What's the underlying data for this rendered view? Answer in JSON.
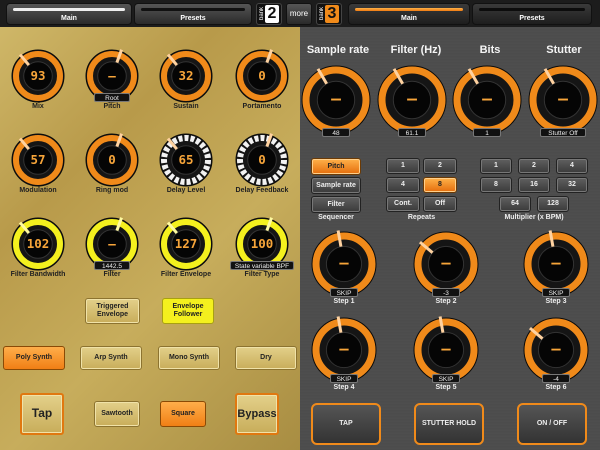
{
  "left_tabs": {
    "main": "Main",
    "presets": "Presets"
  },
  "bank_left": {
    "word": "bank",
    "num": "2"
  },
  "more": "more",
  "bank_right": {
    "word": "bank",
    "num": "3"
  },
  "right_tabs": {
    "main": "Main",
    "presets": "Presets"
  },
  "left_knobs": [
    {
      "label": "Mix",
      "value": "93",
      "style": "orange"
    },
    {
      "label": "Pitch",
      "value": "—",
      "sub": "Root",
      "style": "orange"
    },
    {
      "label": "Sustain",
      "value": "32",
      "style": "orange"
    },
    {
      "label": "Portamento",
      "value": "0",
      "style": "orange"
    },
    {
      "label": "Modulation",
      "value": "57",
      "style": "orange"
    },
    {
      "label": "Ring mod",
      "value": "0",
      "style": "orange"
    },
    {
      "label": "Delay Level",
      "value": "65",
      "style": "white"
    },
    {
      "label": "Delay Feedback",
      "value": "0",
      "style": "white"
    },
    {
      "label": "Filter Bandwidth",
      "value": "102",
      "style": "yellow"
    },
    {
      "label": "Filter",
      "value": "—",
      "sub": "1442.5",
      "style": "yellow"
    },
    {
      "label": "Filter Envelope",
      "value": "127",
      "style": "yellow"
    },
    {
      "label": "Filter Type",
      "value": "100",
      "sub": "State variable BPF",
      "style": "yellow"
    }
  ],
  "env_buttons": {
    "triggered": "Triggered Envelope",
    "follower": "Envelope Follower"
  },
  "synth_buttons": [
    "Poly Synth",
    "Arp Synth",
    "Mono Synth",
    "Dry"
  ],
  "bottom_left": {
    "tap": "Tap",
    "sawtooth": "Sawtooth",
    "square": "Square",
    "bypass": "Bypass"
  },
  "right_top": [
    {
      "title": "Sample rate",
      "value": "—",
      "sub": "48"
    },
    {
      "title": "Filter (Hz)",
      "value": "—",
      "sub": "61.1"
    },
    {
      "title": "Bits",
      "value": "—",
      "sub": "1"
    },
    {
      "title": "Stutter",
      "value": "—",
      "sub": "Stutter Off"
    }
  ],
  "sequencer": {
    "items": [
      "Pitch",
      "Sample rate",
      "Filter"
    ],
    "label": "Sequencer"
  },
  "repeats": {
    "items": [
      "1",
      "2",
      "4",
      "8",
      "Cont.",
      "Off"
    ],
    "label": "Repeats"
  },
  "multiplier": {
    "items": [
      "1",
      "2",
      "4",
      "8",
      "16",
      "32",
      "64",
      "128"
    ],
    "label": "Multiplier (x BPM)"
  },
  "steps": [
    {
      "label": "Step 1",
      "value": "—",
      "sub": "SKIP"
    },
    {
      "label": "Step 2",
      "value": "—",
      "sub": "-3"
    },
    {
      "label": "Step 3",
      "value": "—",
      "sub": "SKIP"
    },
    {
      "label": "Step 4",
      "value": "—",
      "sub": "SKIP"
    },
    {
      "label": "Step 5",
      "value": "—",
      "sub": "SKIP"
    },
    {
      "label": "Step 6",
      "value": "—",
      "sub": "-4"
    }
  ],
  "bottom_right": {
    "tap": "TAP",
    "stutter": "STUTTER HOLD",
    "onoff": "ON / OFF"
  },
  "colors": {
    "orange": "#f08a1a",
    "yellow": "#f4f01e",
    "white": "#f2f2f2",
    "display": "#f7a53a"
  }
}
